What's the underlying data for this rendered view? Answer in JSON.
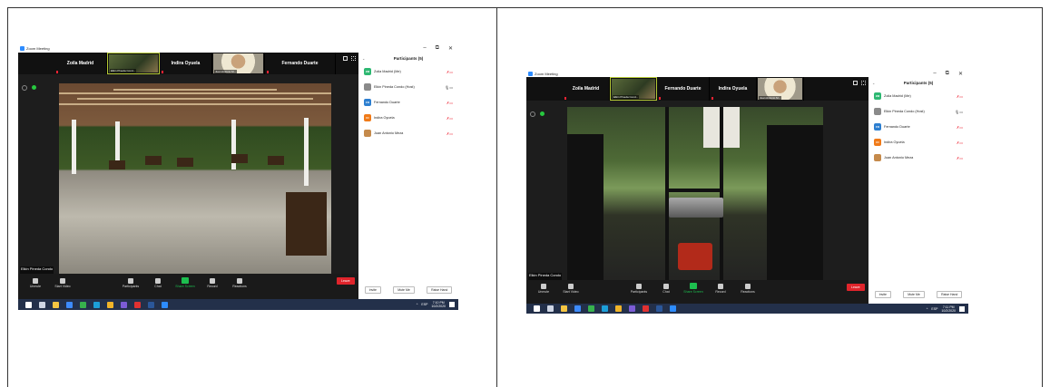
{
  "screens": [
    {
      "window_title": "Zoom Meeting",
      "tiles": [
        {
          "name": "Zoila Madrid",
          "muted": true
        },
        {
          "name": "",
          "tag": "Elkin Pineda Cond...",
          "camera": true,
          "active": true
        },
        {
          "name": "Indira Oyuela",
          "muted": true
        },
        {
          "name": "",
          "tag": "Juan Antonio M...",
          "camera": true,
          "face": true
        },
        {
          "name": "Fernando Duarte",
          "muted": true
        }
      ],
      "speaker_label": "Elkin Pineda Condo",
      "toolbar": [
        "Unmute",
        "Start Video",
        "Participants",
        "Chat",
        "Share Screen",
        "Record",
        "Reactions"
      ],
      "participants_badge": "5",
      "leave_label": "Leave",
      "panel_title": "Participants (5)",
      "participants": [
        {
          "initials": "ZM",
          "name": "Zoila Madrid (Me)",
          "color": "#2eb872",
          "status": "muted"
        },
        {
          "initials": "",
          "name": "Elkin Pineda Condo (Host)",
          "color": "#8a8a8a",
          "status": "ok",
          "photo": true
        },
        {
          "initials": "FD",
          "name": "Fernando Duarte",
          "color": "#2d7fd0",
          "status": "muted"
        },
        {
          "initials": "IO",
          "name": "Indira Oyuela",
          "color": "#f07a18",
          "status": "muted"
        },
        {
          "initials": "",
          "name": "Juan Antonio Meza",
          "color": "#c58a4b",
          "status": "muted",
          "photo": true
        }
      ],
      "footer": [
        "Invite",
        "Mute Me",
        "Raise Hand"
      ],
      "clock_time": "7:10 PM",
      "clock_date": "10/2/2020",
      "lang": "ESP"
    },
    {
      "window_title": "Zoom Meeting",
      "tiles": [
        {
          "name": "Zoila Madrid",
          "muted": true
        },
        {
          "name": "",
          "tag": "Elkin Pineda Cond...",
          "camera": true,
          "active": true
        },
        {
          "name": "Fernando Duarte",
          "muted": true
        },
        {
          "name": "Indira Oyuela",
          "muted": true
        },
        {
          "name": "",
          "tag": "Juan Antonio M...",
          "camera": true,
          "face": true
        }
      ],
      "speaker_label": "Elkin Pineda Condo",
      "toolbar": [
        "Unmute",
        "Start Video",
        "Participants",
        "Chat",
        "Share Screen",
        "Record",
        "Reactions"
      ],
      "participants_badge": "5",
      "leave_label": "Leave",
      "panel_title": "Participants (5)",
      "participants": [
        {
          "initials": "ZM",
          "name": "Zoila Madrid (Me)",
          "color": "#2eb872",
          "status": "muted"
        },
        {
          "initials": "",
          "name": "Elkin Pineda Condo (Host)",
          "color": "#8a8a8a",
          "status": "ok",
          "photo": true
        },
        {
          "initials": "FD",
          "name": "Fernando Duarte",
          "color": "#2d7fd0",
          "status": "muted"
        },
        {
          "initials": "IO",
          "name": "Indira Oyuela",
          "color": "#f07a18",
          "status": "muted"
        },
        {
          "initials": "",
          "name": "Juan Antonio Meza",
          "color": "#c58a4b",
          "status": "muted",
          "photo": true
        }
      ],
      "footer": [
        "Invite",
        "Mute Me",
        "Raise Hand"
      ],
      "clock_time": "7:11 PM",
      "clock_date": "10/2/2020",
      "lang": "ESP"
    }
  ]
}
